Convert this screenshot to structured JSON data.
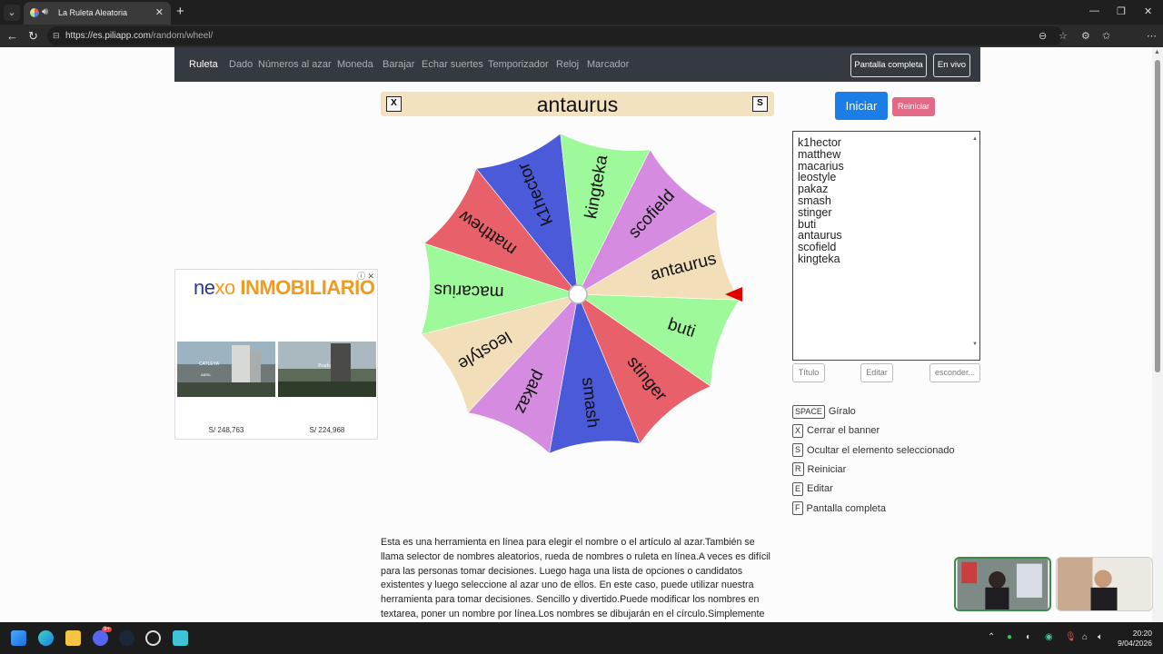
{
  "browser": {
    "tab_title": "La Ruleta Aleatoria",
    "url_host": "https://es.piliapp.com",
    "url_path": "/random/wheel/"
  },
  "nav": {
    "items": [
      "Ruleta",
      "Dado",
      "Números al azar",
      "Moneda",
      "Barajar",
      "Echar suertes",
      "Temporizador",
      "Reloj",
      "Marcador"
    ],
    "fullscreen_button": "Pantalla completa",
    "live_button": "En vivo"
  },
  "banner": {
    "close_key": "X",
    "hide_key": "S",
    "selected": "antaurus"
  },
  "controls": {
    "start_label": "Iniciar",
    "reset_label": "Reiniciar"
  },
  "wheel": {
    "pointer_color": "#e00000",
    "segments": [
      {
        "name": "buti",
        "color": "#9ef99a"
      },
      {
        "name": "stinger",
        "color": "#e8606a"
      },
      {
        "name": "smash",
        "color": "#4a5ad8"
      },
      {
        "name": "pakaz",
        "color": "#d58ce0"
      },
      {
        "name": "leostyle",
        "color": "#f2deb9"
      },
      {
        "name": "macarius",
        "color": "#9ef99a"
      },
      {
        "name": "matthew",
        "color": "#e8606a"
      },
      {
        "name": "k1hector",
        "color": "#4a5ad8"
      },
      {
        "name": "kingteka",
        "color": "#9ef99a"
      },
      {
        "name": "scofield",
        "color": "#d58ce0"
      },
      {
        "name": "antaurus",
        "color": "#f2deb9"
      }
    ]
  },
  "names_list": [
    "k1hector",
    "matthew",
    "macarius",
    "leostyle",
    "pakaz",
    "smash",
    "stinger",
    "buti",
    "antaurus",
    "scofield",
    "kingteka"
  ],
  "list_buttons": {
    "title": "Título",
    "edit": "Editar",
    "hide": "esconder..."
  },
  "shortcuts": [
    {
      "key": "SPACE",
      "label": "Gíralo"
    },
    {
      "key": "X",
      "label": "Cerrar el banner"
    },
    {
      "key": "S",
      "label": "Ocultar el elemento seleccionado"
    },
    {
      "key": "R",
      "label": "Reiniciar"
    },
    {
      "key": "E",
      "label": "Editar"
    },
    {
      "key": "F",
      "label": "Pantalla completa"
    }
  ],
  "ad": {
    "brand_ne": "ne",
    "brand_xo": "xo",
    "brand_rest": "INMOBILIARIO",
    "project1": "CATLEYA",
    "project1_sub": "ABRIL",
    "project2": "Prado",
    "price1": "S/ 248,763",
    "price2": "S/ 224,968"
  },
  "description": "Esta es una herramienta en línea para elegir el nombre o el artículo al azar.También se llama selector de nombres aleatorios, rueda de nombres o ruleta en línea.A veces es difícil para las personas tomar decisiones. Luego haga una lista de opciones o candidatos existentes y luego seleccione al azar uno de ellos. En este caso, puede utilizar nuestra herramienta para tomar decisiones. Sencillo y divertido.Puede modificar los nombres en textarea, poner un nombre por línea.Los nombres se dibujarán en el círculo.Simplemente haga clic en la rueda",
  "taskbar": {
    "time": "20:20",
    "date": "9/04/2026",
    "discord_badge": "9+"
  }
}
